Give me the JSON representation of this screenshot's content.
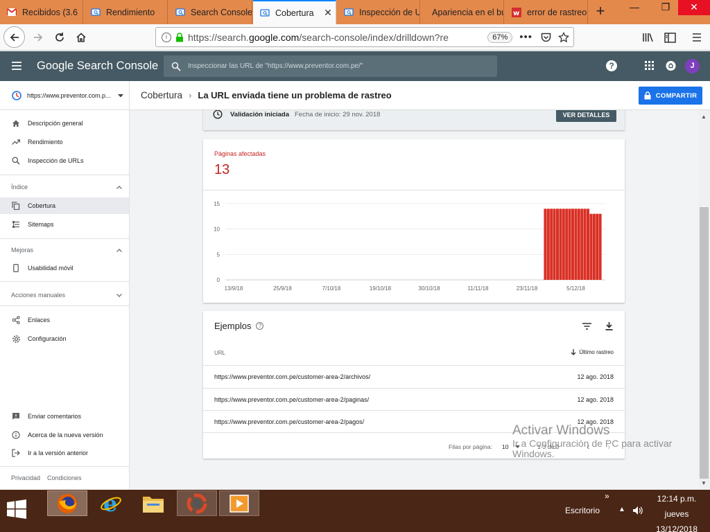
{
  "browser": {
    "tabs": [
      {
        "label": "Recibidos (3.6",
        "icon": "gmail-icon",
        "left": 0,
        "width": 120
      },
      {
        "label": "Rendimiento",
        "icon": "search-console-icon",
        "left": 121,
        "width": 121
      },
      {
        "label": "Search Console",
        "icon": "search-console-icon",
        "left": 243,
        "width": 121
      },
      {
        "label": "Cobertura",
        "icon": "search-console-icon",
        "left": 365,
        "width": 120
      },
      {
        "label": "Inspección de U",
        "icon": "search-console-icon",
        "left": 486,
        "width": 120
      },
      {
        "label": "Apariencia en el bu",
        "icon": "",
        "left": 607,
        "width": 120
      },
      {
        "label": "error de rastreo",
        "icon": "web-icon",
        "left": 728,
        "width": 120
      }
    ],
    "active_tab": 3,
    "url_prefix": "https://search.",
    "url_domain": "google.com",
    "url_rest": "/search-console/index/drilldown?re",
    "zoom": "67%"
  },
  "gsc": {
    "brand": "Google Search Console",
    "search_placeholder": "Inspeccionar las URL de \"https://www.preventor.com.pe/\"",
    "avatar_letter": "J",
    "property": "https://www.preventor.com.p...",
    "breadcrumb_parent": "Cobertura",
    "breadcrumb_current": "La URL enviada tiene un problema de rastreo",
    "share_label": "COMPARTIR"
  },
  "sidebar": {
    "top_items": [
      {
        "label": "Descripción general",
        "icon": "home-icon"
      },
      {
        "label": "Rendimiento",
        "icon": "trending-up-icon"
      },
      {
        "label": "Inspección de URLs",
        "icon": "search-icon"
      }
    ],
    "group_index": "Índice",
    "index_items": [
      {
        "label": "Cobertura",
        "icon": "copy-icon"
      },
      {
        "label": "Sitemaps",
        "icon": "sitemap-icon"
      }
    ],
    "group_mejoras": "Mejoras",
    "mejoras_items": [
      {
        "label": "Usabilidad móvil",
        "icon": "phone-icon"
      }
    ],
    "group_acciones": "Acciones manuales",
    "other_items": [
      {
        "label": "Enlaces",
        "icon": "links-icon"
      },
      {
        "label": "Configuración",
        "icon": "gear-icon"
      }
    ],
    "bottom_items": [
      {
        "label": "Enviar comentarios",
        "icon": "feedback-icon"
      },
      {
        "label": "Acerca de la nueva versión",
        "icon": "info-icon"
      },
      {
        "label": "Ir a la versión anterior",
        "icon": "exit-icon"
      }
    ],
    "footer_privacy": "Privacidad",
    "footer_terms": "Condiciones"
  },
  "validation": {
    "title": "Validación iniciada",
    "date": "Fecha de inicio: 29 nov. 2018",
    "button": "VER DETALLES"
  },
  "affected": {
    "label": "Páginas afectadas",
    "value": "13",
    "color": "#c5221f"
  },
  "chart_data": {
    "type": "bar",
    "ylim": [
      0,
      15
    ],
    "yticks": [
      0,
      5,
      10,
      15
    ],
    "x_tick_labels": [
      "13/9/18",
      "25/9/18",
      "7/10/18",
      "19/10/18",
      "30/10/18",
      "11/11/18",
      "23/11/18",
      "5/12/18"
    ],
    "values": [
      14,
      14,
      14,
      14,
      14,
      14,
      14,
      14,
      14,
      14,
      14,
      14,
      14,
      14,
      14,
      13,
      13,
      13,
      13
    ],
    "bar_color": "#d93025"
  },
  "examples": {
    "title": "Ejemplos",
    "col_url": "URL",
    "col_date": "Último rastreo",
    "rows": [
      {
        "url": "https://www.preventor.com.pe/customer-area-2/archivos/",
        "date": "12 ago. 2018"
      },
      {
        "url": "https://www.preventor.com.pe/customer-area-2/paginas/",
        "date": "12 ago. 2018"
      },
      {
        "url": "https://www.preventor.com.pe/customer-area-2/pagos/",
        "date": "12 ago. 2018"
      }
    ],
    "rows_per_page_label": "Filas por página:",
    "rows_per_page": "10",
    "range": "1-3 de 3"
  },
  "watermark": {
    "line1": "Activar Windows",
    "line2": "Ir a Configuración de PC para activar",
    "line3": "Windows."
  },
  "taskbar": {
    "desktop_label": "Escritorio",
    "time": "12:14 p.m.",
    "day": "jueves",
    "date": "13/12/2018",
    "accent": "#4a2616"
  }
}
